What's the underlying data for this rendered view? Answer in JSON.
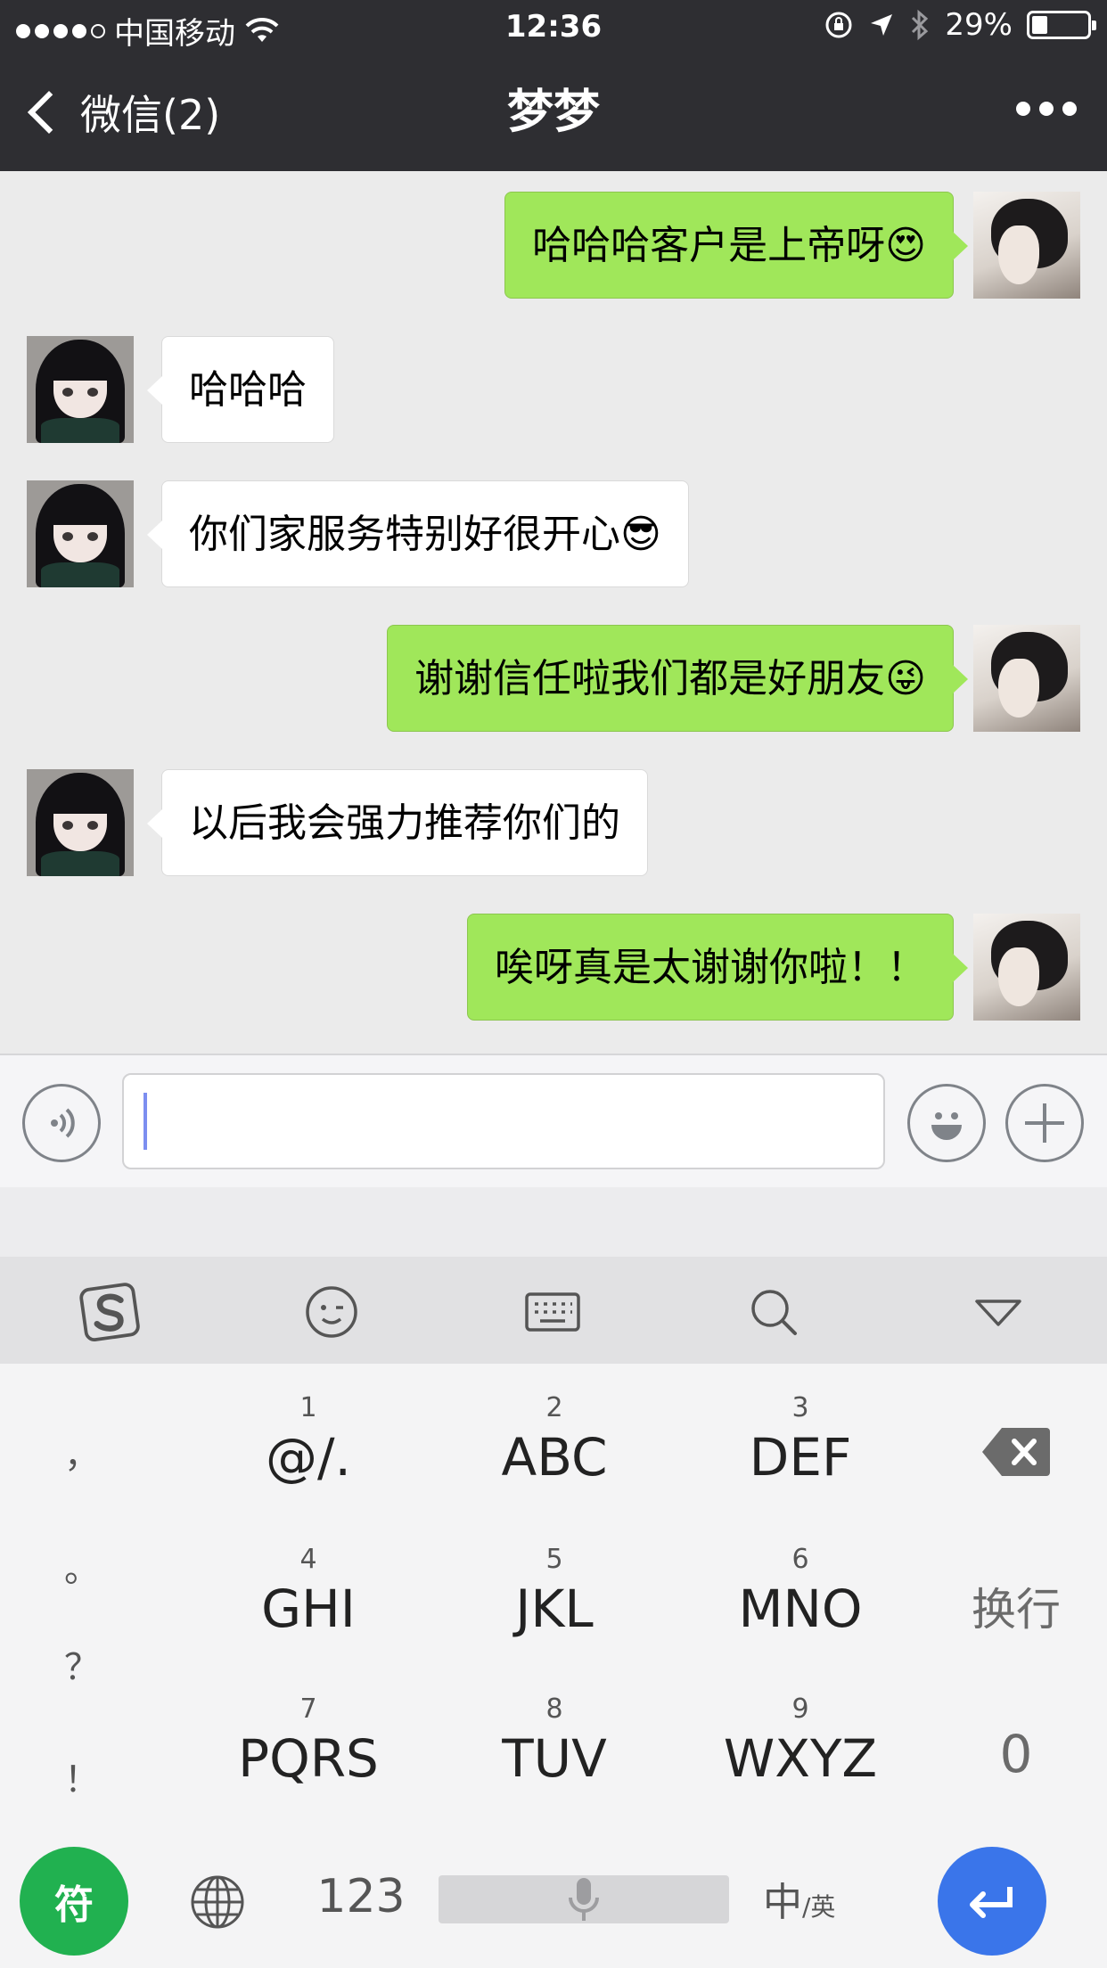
{
  "status": {
    "carrier": "中国移动",
    "time": "12:36",
    "battery": "29%",
    "battery_level": 0.29
  },
  "nav": {
    "back_label": "微信(2)",
    "title": "梦梦"
  },
  "messages": [
    {
      "side": "out",
      "text": "哈哈哈客户是上帝呀😍"
    },
    {
      "side": "in",
      "text": "哈哈哈"
    },
    {
      "side": "in",
      "text": "你们家服务特别好很开心😎"
    },
    {
      "side": "out",
      "text": "谢谢信任啦我们都是好朋友😜"
    },
    {
      "side": "in",
      "text": "以后我会强力推荐你们的"
    },
    {
      "side": "out",
      "text": "唉呀真是太谢谢你啦！！"
    }
  ],
  "input": {
    "value": ""
  },
  "keyboard": {
    "punctuation": [
      "，",
      "。",
      "？",
      "！"
    ],
    "keys": [
      {
        "num": "1",
        "letters": "@/."
      },
      {
        "num": "2",
        "letters": "ABC"
      },
      {
        "num": "3",
        "letters": "DEF"
      },
      {
        "num": "4",
        "letters": "GHI"
      },
      {
        "num": "5",
        "letters": "JKL"
      },
      {
        "num": "6",
        "letters": "MNO"
      },
      {
        "num": "7",
        "letters": "PQRS"
      },
      {
        "num": "8",
        "letters": "TUV"
      },
      {
        "num": "9",
        "letters": "WXYZ"
      }
    ],
    "newline_label": "换行",
    "zero_label": "0",
    "symbol_label": "符",
    "number_label": "123",
    "lang_main": "中",
    "lang_sub": "/英"
  }
}
